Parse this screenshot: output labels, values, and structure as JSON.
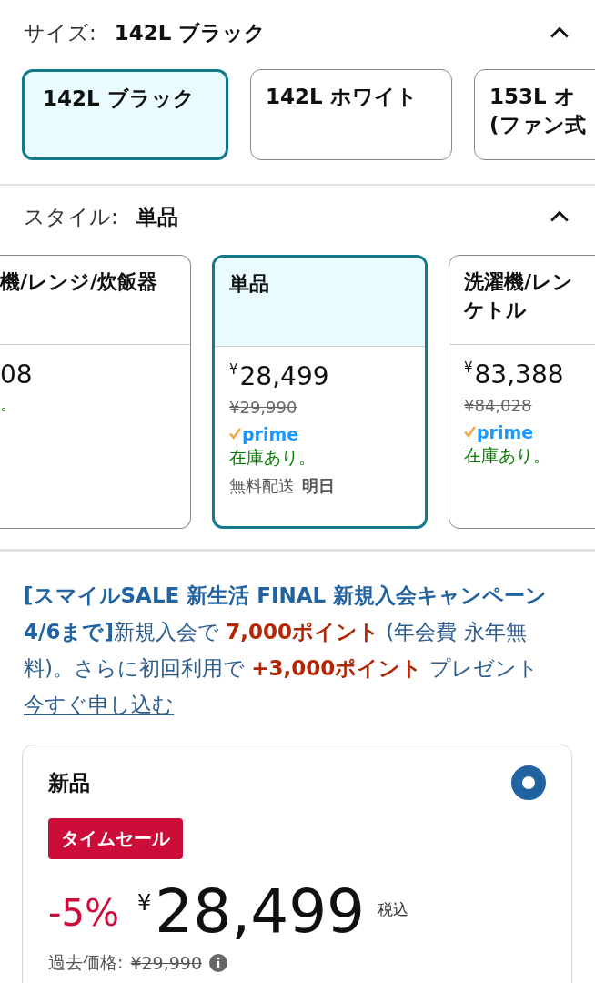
{
  "size": {
    "label": "サイズ:",
    "value": "142L ブラック",
    "expanded": true,
    "options": [
      {
        "lines": [
          "142L ブラック"
        ],
        "selected": true
      },
      {
        "lines": [
          "142L ホワイト"
        ],
        "selected": false
      },
      {
        "lines": [
          "153L オ",
          "(ファン式"
        ],
        "selected": false
      }
    ]
  },
  "style": {
    "label": "スタイル:",
    "value": "単品",
    "expanded": true,
    "options": [
      {
        "title_lines": [
          "機/レンジ/炊飯器"
        ],
        "price": "08",
        "stock": "。",
        "selected": false
      },
      {
        "title_lines": [
          "単品"
        ],
        "currency": "¥",
        "price": "28,499",
        "list_price": "¥29,990",
        "prime": "prime",
        "stock": "在庫あり。",
        "delivery": "無料配送",
        "delivery_day": "明日",
        "selected": true
      },
      {
        "title_lines": [
          "洗濯機/レン",
          "ケトル"
        ],
        "currency": "¥",
        "price": "83,388",
        "list_price": "¥84,028",
        "prime": "prime",
        "stock": "在庫あり。",
        "selected": false
      }
    ]
  },
  "promo": {
    "segments": [
      {
        "kind": "campaign",
        "text": "[スマイルSALE 新生活 FINAL 新規入会キャンペーン 4/6まで]"
      },
      {
        "kind": "text",
        "text": "新規入会で "
      },
      {
        "kind": "points",
        "text": "7,000ポイント"
      },
      {
        "kind": "text",
        "text": " (年会費 永年無料)。さらに初回利用で "
      },
      {
        "kind": "points",
        "text": "+3,000ポイント"
      },
      {
        "kind": "text",
        "text": " プレゼント "
      },
      {
        "kind": "link",
        "text": "今すぐ申し込む"
      }
    ]
  },
  "offer": {
    "title": "新品",
    "selected": true,
    "badge": "タイムセール",
    "discount": "-5%",
    "currency": "¥",
    "price": "28,499",
    "tax_note": "税込",
    "past_price_label": "過去価格:",
    "past_price": "¥29,990"
  }
}
